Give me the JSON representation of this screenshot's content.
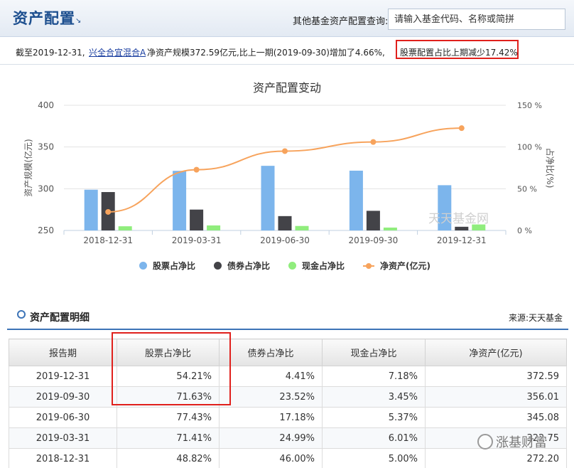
{
  "header": {
    "title": "资产配置",
    "query_label": "其他基金资产配置查询:",
    "search_placeholder": "请输入基金代码、名称或简拼"
  },
  "summary": {
    "prefix": "截至2019-12-31,",
    "fund_name": "兴全合宜混合A",
    "scale_text": "净资产规模372.59亿元,比上一期(2019-09-30)增加了4.66%,",
    "highlight_text": "股票配置占比上期减少17.42%"
  },
  "chart_data": {
    "type": "bar",
    "title": "资产配置变动",
    "categories": [
      "2018-12-31",
      "2019-03-31",
      "2019-06-30",
      "2019-09-30",
      "2019-12-31"
    ],
    "series": [
      {
        "name": "股票占净比",
        "type": "bar",
        "axis": "right",
        "values": [
          48.82,
          71.41,
          77.43,
          71.63,
          54.21
        ],
        "color": "#7cb5ec"
      },
      {
        "name": "债券占净比",
        "type": "bar",
        "axis": "right",
        "values": [
          46.0,
          24.99,
          17.18,
          23.52,
          4.41
        ],
        "color": "#434348"
      },
      {
        "name": "现金占净比",
        "type": "bar",
        "axis": "right",
        "values": [
          5.0,
          6.01,
          5.37,
          3.45,
          7.18
        ],
        "color": "#90ed7d"
      },
      {
        "name": "净资产(亿元)",
        "type": "line",
        "axis": "left",
        "values": [
          272.2,
          322.75,
          345.08,
          356.01,
          372.59
        ],
        "color": "#f7a35c"
      }
    ],
    "ylabel_left": "资产规模(亿元)",
    "ylabel_right": "占净比(%)",
    "ylim_left": [
      250,
      400
    ],
    "yticks_left": [
      "400",
      "350",
      "300",
      "250"
    ],
    "ylim_right": [
      0,
      150
    ],
    "yticks_right": [
      "150 %",
      "100 %",
      "50 %",
      "0 %"
    ],
    "grid": true,
    "legend_position": "bottom",
    "watermark": "天天基金网"
  },
  "detail": {
    "title": "资产配置明细",
    "source": "来源:天天基金",
    "columns": [
      "报告期",
      "股票占净比",
      "债券占净比",
      "现金占净比",
      "净资产(亿元)"
    ],
    "rows": [
      [
        "2019-12-31",
        "54.21%",
        "4.41%",
        "7.18%",
        "372.59"
      ],
      [
        "2019-09-30",
        "71.63%",
        "23.52%",
        "3.45%",
        "356.01"
      ],
      [
        "2019-06-30",
        "77.43%",
        "17.18%",
        "5.37%",
        "345.08"
      ],
      [
        "2019-03-31",
        "71.41%",
        "24.99%",
        "6.01%",
        "322.75"
      ],
      [
        "2018-12-31",
        "48.82%",
        "46.00%",
        "5.00%",
        "272.20"
      ]
    ]
  },
  "watermark": {
    "brand": "涨基财富"
  }
}
